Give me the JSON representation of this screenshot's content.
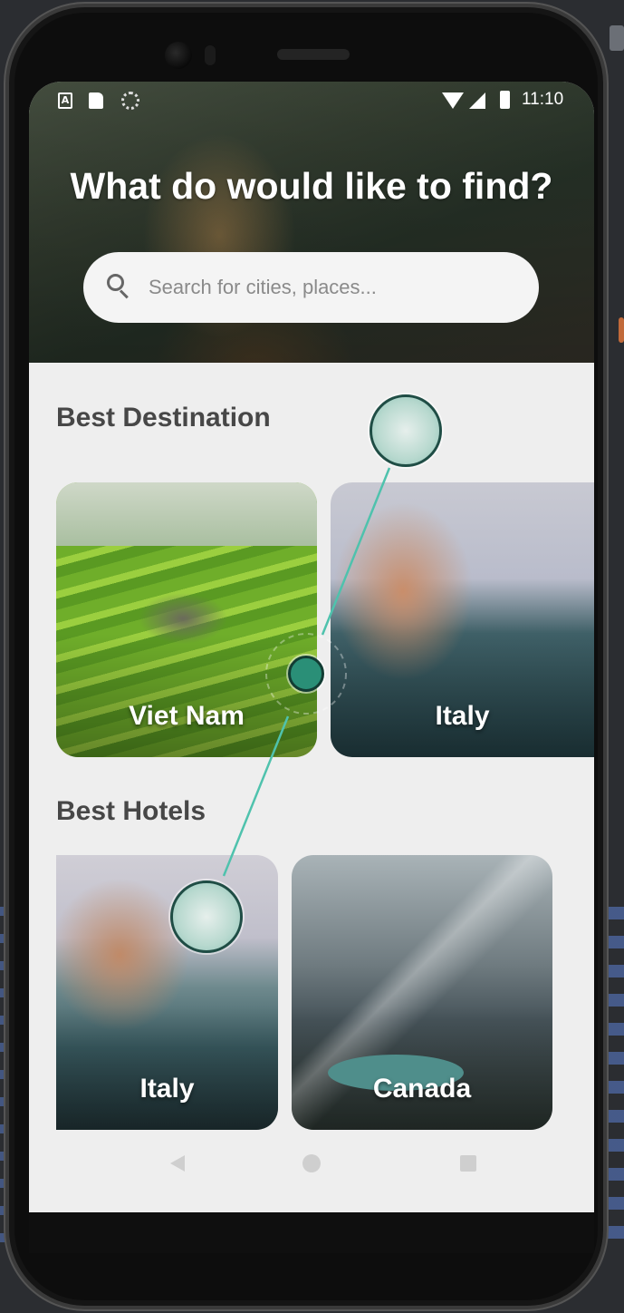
{
  "status_bar": {
    "time": "11:10",
    "icons": [
      "a-badge-icon",
      "sd-card-icon",
      "sync-icon",
      "wifi-icon",
      "cell-signal-icon",
      "battery-icon"
    ]
  },
  "header": {
    "title": "What do would like to find?",
    "search": {
      "placeholder": "Search for cities, places..."
    }
  },
  "best_destination": {
    "title": "Best Destination",
    "cards": [
      {
        "label": "Viet Nam"
      },
      {
        "label": "Italy"
      }
    ]
  },
  "best_hotels": {
    "title": "Best Hotels",
    "cards": [
      {
        "label": "Italy"
      },
      {
        "label": "Canada"
      }
    ]
  },
  "nav_bar": {
    "icons": [
      "back-icon",
      "home-icon",
      "recents-icon"
    ]
  }
}
